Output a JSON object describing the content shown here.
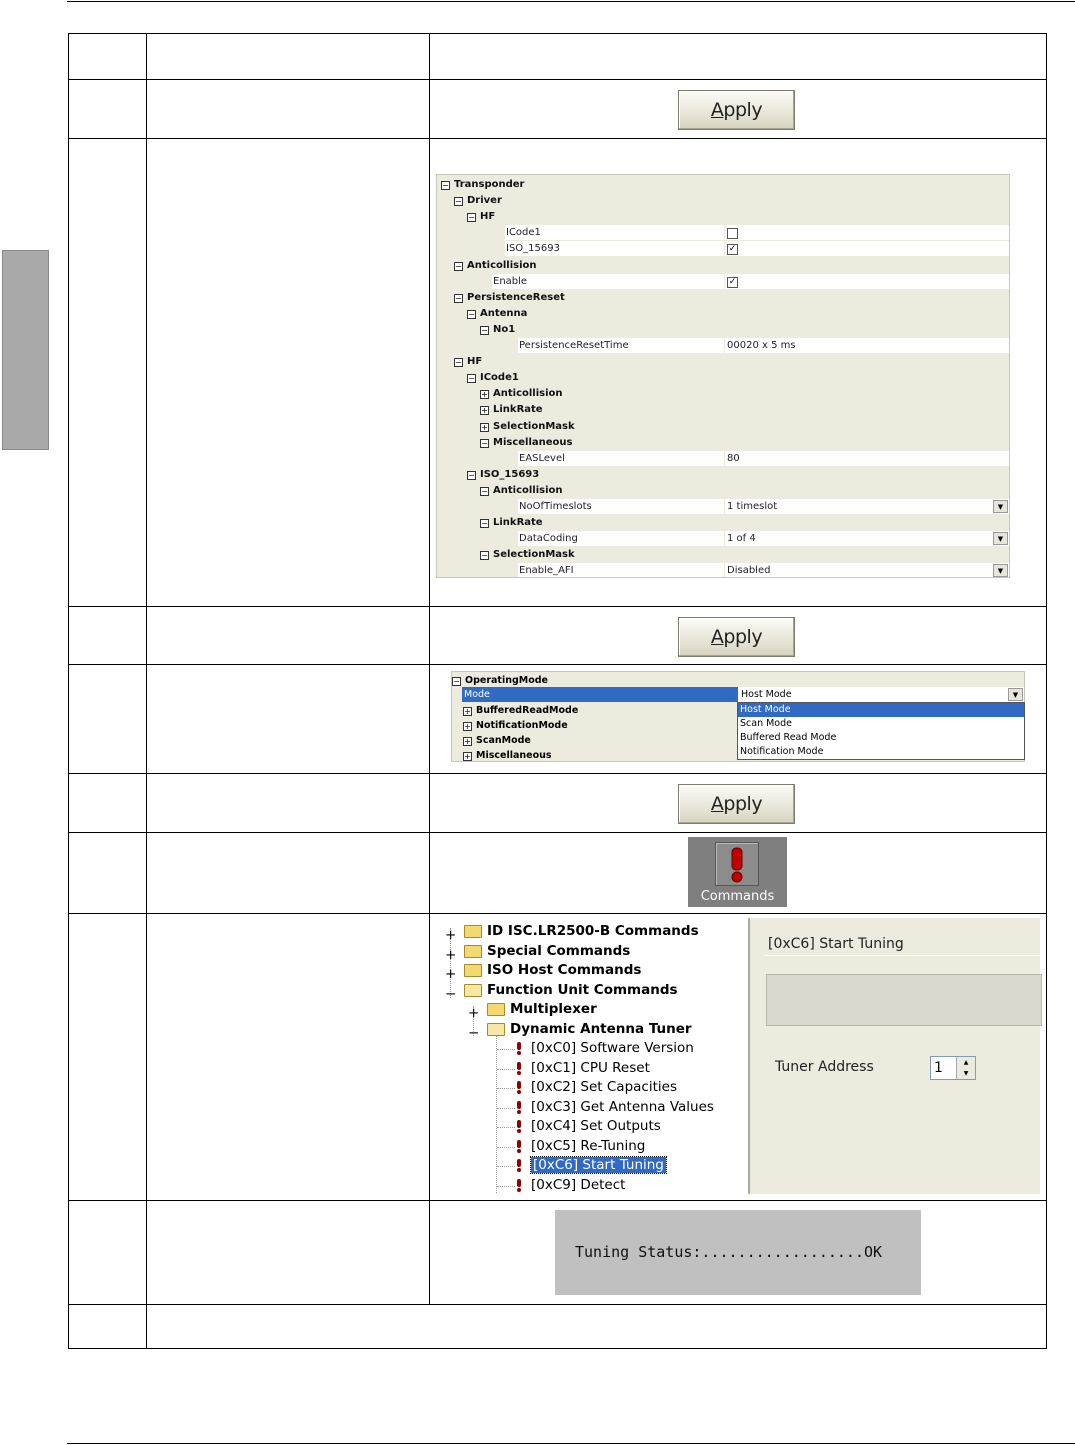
{
  "apply_label": "Apply",
  "property_tree": {
    "rows": [
      {
        "type": "cat",
        "indent": 0,
        "exp": "−",
        "label": "Transponder"
      },
      {
        "type": "cat",
        "indent": 1,
        "exp": "−",
        "label": "Driver"
      },
      {
        "type": "cat",
        "indent": 2,
        "exp": "−",
        "label": "HF"
      },
      {
        "type": "leaf",
        "indent": 3,
        "label": "ICode1",
        "check": false
      },
      {
        "type": "leaf",
        "indent": 3,
        "label": "ISO_15693",
        "check": true
      },
      {
        "type": "cat",
        "indent": 1,
        "exp": "−",
        "label": "Anticollision"
      },
      {
        "type": "leaf",
        "indent": 2,
        "label": "Enable",
        "check": true
      },
      {
        "type": "cat",
        "indent": 1,
        "exp": "−",
        "label": "PersistenceReset"
      },
      {
        "type": "cat",
        "indent": 2,
        "exp": "−",
        "label": "Antenna"
      },
      {
        "type": "cat",
        "indent": 3,
        "exp": "−",
        "label": "No1"
      },
      {
        "type": "leaf",
        "indent": 4,
        "label": "PersistenceResetTime",
        "value": "00020 x 5 ms"
      },
      {
        "type": "cat",
        "indent": 1,
        "exp": "−",
        "label": "HF"
      },
      {
        "type": "cat",
        "indent": 2,
        "exp": "−",
        "label": "ICode1"
      },
      {
        "type": "cat",
        "indent": 3,
        "exp": "+",
        "label": "Anticollision"
      },
      {
        "type": "cat",
        "indent": 3,
        "exp": "+",
        "label": "LinkRate"
      },
      {
        "type": "cat",
        "indent": 3,
        "exp": "+",
        "label": "SelectionMask"
      },
      {
        "type": "cat",
        "indent": 3,
        "exp": "−",
        "label": "Miscellaneous"
      },
      {
        "type": "leaf",
        "indent": 4,
        "label": "EASLevel",
        "value": "80"
      },
      {
        "type": "cat",
        "indent": 2,
        "exp": "−",
        "label": "ISO_15693"
      },
      {
        "type": "cat",
        "indent": 3,
        "exp": "−",
        "label": "Anticollision"
      },
      {
        "type": "leaf",
        "indent": 4,
        "label": "NoOfTimeslots",
        "value": "1 timeslot",
        "dropdown": true
      },
      {
        "type": "cat",
        "indent": 3,
        "exp": "−",
        "label": "LinkRate"
      },
      {
        "type": "leaf",
        "indent": 4,
        "label": "DataCoding",
        "value": "1 of 4",
        "dropdown": true
      },
      {
        "type": "cat",
        "indent": 3,
        "exp": "−",
        "label": "SelectionMask"
      },
      {
        "type": "leaf",
        "indent": 4,
        "label": "Enable_AFI",
        "value": "Disabled",
        "dropdown": true
      }
    ]
  },
  "operating_mode": {
    "header": "OperatingMode",
    "mode_label": "Mode",
    "mode_value": "Host Mode",
    "sub_items": [
      "BufferedReadMode",
      "NotificationMode",
      "ScanMode",
      "Miscellaneous"
    ],
    "options": [
      "Host Mode",
      "Scan Mode",
      "Buffered Read Mode",
      "Notification Mode"
    ],
    "selected_option": 0
  },
  "commands_button": "Commands",
  "command_tree": {
    "folders": [
      {
        "label": "ID ISC.LR2500-B Commands",
        "exp": "+",
        "indent": 0
      },
      {
        "label": "Special Commands",
        "exp": "+",
        "indent": 0
      },
      {
        "label": "ISO Host Commands",
        "exp": "+",
        "indent": 0
      },
      {
        "label": "Function Unit Commands",
        "exp": "−",
        "indent": 0,
        "open": true
      },
      {
        "label": "Multiplexer",
        "exp": "+",
        "indent": 1
      },
      {
        "label": "Dynamic Antenna Tuner",
        "exp": "−",
        "indent": 1,
        "open": true
      }
    ],
    "commands": [
      "[0xC0] Software Version",
      "[0xC1] CPU Reset",
      "[0xC2] Set Capacities",
      "[0xC3] Get Antenna Values",
      "[0xC4] Set Outputs",
      "[0xC5] Re-Tuning",
      "[0xC6] Start Tuning",
      "[0xC9] Detect"
    ],
    "selected_command": 6
  },
  "command_panel": {
    "title": "[0xC6] Start Tuning",
    "tuner_label": "Tuner Address",
    "tuner_value": "1"
  },
  "tuning_status": "Tuning Status:..................OK"
}
